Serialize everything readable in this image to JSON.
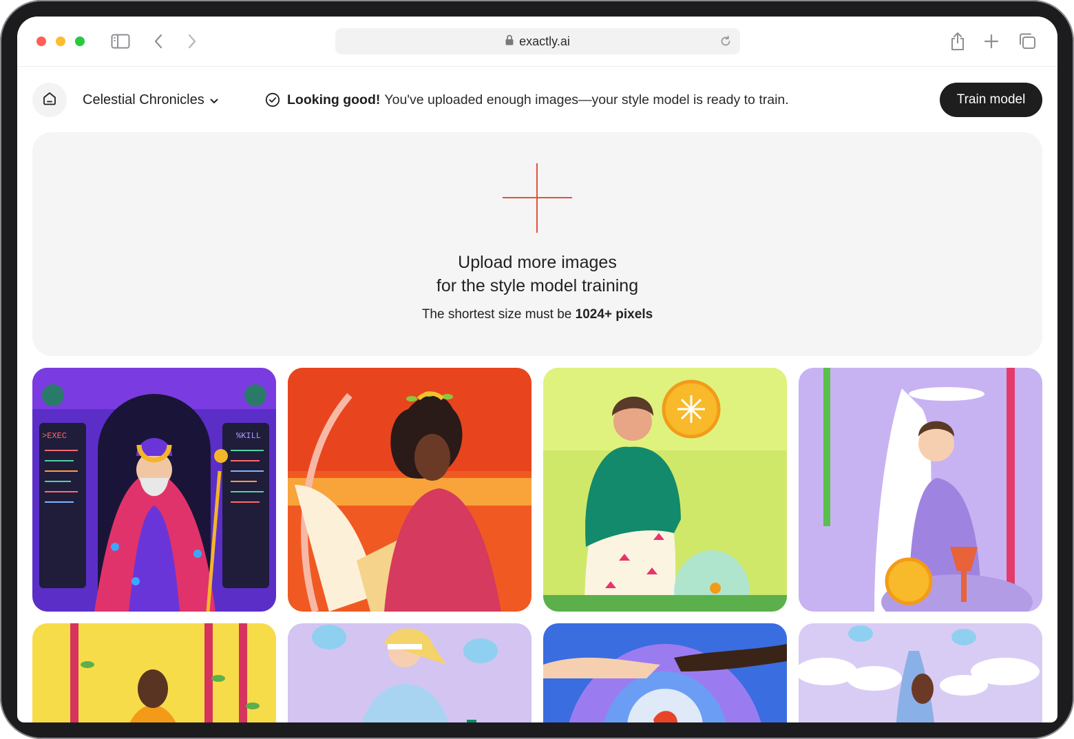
{
  "browser": {
    "url": "exactly.ai",
    "icons": [
      "sidebar-icon",
      "back-icon",
      "forward-icon",
      "lock-icon",
      "reload-icon",
      "share-icon",
      "new-tab-icon",
      "tabs-overview-icon"
    ]
  },
  "toolbar": {
    "project_name": "Celestial Chronicles",
    "status_bold": "Looking good!",
    "status_text": "You've uploaded enough images—your style model is ready to train.",
    "train_label": "Train model"
  },
  "upload": {
    "title_line1": "Upload more images",
    "title_line2": "for the style model training",
    "note_prefix": "The shortest size must be",
    "note_bold": "1024+ pixels"
  },
  "colors": {
    "accent": "#e2513a",
    "primary_button": "#1e1e1e",
    "dropzone_bg": "#f5f5f5"
  },
  "gallery": {
    "images": [
      {
        "label": "wizard card",
        "snippets": [
          ">EXEC",
          "%KILL"
        ]
      },
      {
        "label": "woman with crown card"
      },
      {
        "label": "woman with coin card"
      },
      {
        "label": "man with cup card"
      },
      {
        "label": "tree climbing card"
      },
      {
        "label": "blindfolded woman card"
      },
      {
        "label": "hands over orb card"
      },
      {
        "label": "cloud figure card"
      }
    ]
  }
}
